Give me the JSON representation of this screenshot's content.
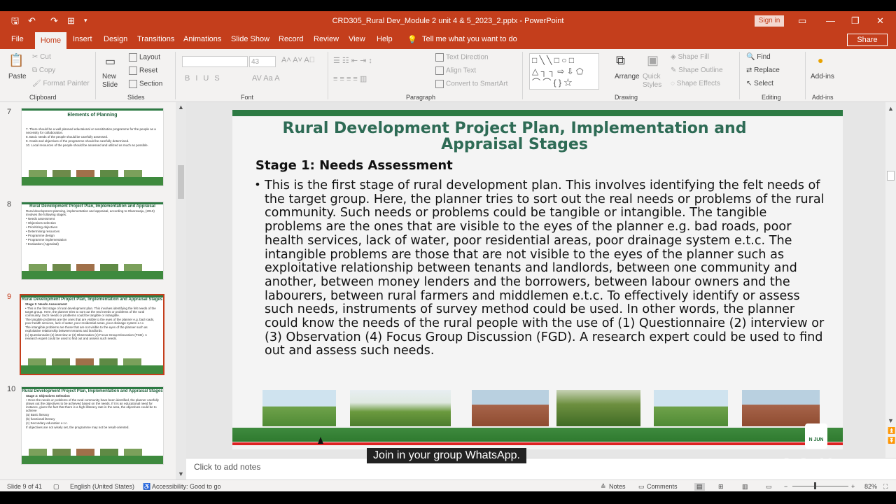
{
  "window": {
    "doc_title": "CRD305_Rural Dev_Module 2 unit 4 & 5_2023_2.pptx  -  PowerPoint",
    "sign_in": "Sign in",
    "share": "Share"
  },
  "tabs": [
    "File",
    "Home",
    "Insert",
    "Design",
    "Transitions",
    "Animations",
    "Slide Show",
    "Record",
    "Review",
    "View",
    "Help"
  ],
  "tell_me": "Tell me what you want to do",
  "ribbon": {
    "clipboard": {
      "paste": "Paste",
      "cut": "Cut",
      "copy": "Copy",
      "format_painter": "Format Painter",
      "group": "Clipboard"
    },
    "slides": {
      "new_slide": "New Slide",
      "layout": "Layout",
      "reset": "Reset",
      "section": "Section",
      "group": "Slides"
    },
    "font": {
      "font_size": "43",
      "group": "Font"
    },
    "paragraph": {
      "text_direction": "Text Direction",
      "align_text": "Align Text",
      "convert": "Convert to SmartArt",
      "group": "Paragraph"
    },
    "drawing": {
      "arrange": "Arrange",
      "quick_styles": "Quick Styles",
      "shape_fill": "Shape Fill",
      "shape_outline": "Shape Outline",
      "shape_effects": "Shape Effects",
      "group": "Drawing"
    },
    "editing": {
      "find": "Find",
      "replace": "Replace",
      "select": "Select",
      "group": "Editing"
    },
    "addins": {
      "label": "Add-ins",
      "group": "Add-ins"
    }
  },
  "thumbnails": [
    {
      "num": "7",
      "title": "Elements of Planning",
      "lines": [
        "7. There should be a well planned educational or sensitization programme for the people as a necessity for collaboration.",
        "8. Basic needs of the people should be carefully assessed.",
        "9. Goals and objectives of the programme should be carefully determined.",
        "10. Local resources of the people should be assessed and utilized as much as possible."
      ]
    },
    {
      "num": "8",
      "title": "Rural Development Project Plan, Implementation and Appraisal",
      "lines": [
        "Rural development planning, implementation and appraisal, according to Olanrewaju, (2010) involves the following stages:",
        "• Needs assessment",
        "• Objectives selection",
        "• Prioritizing objectives",
        "• Determining resources",
        "• Programme design",
        "• Programme implementation",
        "• Evaluation (Appraisal)"
      ]
    },
    {
      "num": "9",
      "title": "Rural Development Project Plan, Implementation and Appraisal Stages",
      "lines": [
        "Stage 1: Needs Assessment",
        "• This is the first stage of rural development plan. This involves identifying the felt needs of the target group. Here, the planner tries to sort out the real needs or problems of the rural community. Such needs or problems could be tangible or intangible.",
        "The tangible problems are the ones that are visible to the eyes of the planner e.g. bad roads, poor health services, lack of water, poor residential areas, poor drainage system e.t.c.",
        "The intangible problems are those that are not visible to the eyes of the planner such as exploitative relationship between tenants and landlords.",
        "(1) Questionnaire (2) interview or (3) Observation (4) Focus Group Discussion (FGD). A research expert could be used to find out and assess such needs."
      ]
    },
    {
      "num": "10",
      "title": "Rural Development Project Plan, Implementation and Appraisal Stages",
      "lines": [
        "Stage 2: Objectives Selection",
        "• Once the needs or problems of the rural community have been identified, the planner carefully draws out the objectives to be achieved based on the needs. If it is an educational need for instance, given the fact that there is a high illiteracy rate in the area, the objectives could be to achieve",
        "(a) Basic literacy",
        "(b) functional literacy",
        "(c) Secondary education e.t.c.",
        "If objectives are not wisely set, the programme may not be result-oriented."
      ]
    }
  ],
  "slide": {
    "title": "Rural Development Project Plan, Implementation and Appraisal Stages",
    "heading": "Stage 1: Needs Assessment",
    "bullet": "•",
    "body": "This is the first stage of rural development plan. This involves identifying the felt needs of the target group. Here, the planner tries to sort out the real needs or problems of the rural community. Such needs or problems could be tangible or intangible. The tangible problems are the ones that are visible to the eyes of the planner e.g. bad roads, poor health services, lack of water, poor residential areas, poor drainage system e.t.c. The intangible problems are those that are not visible to the eyes of the planner such as exploitative relationship between tenants and landlords, between one community and another, between money lenders and the borrowers, between labour owners and the labourers, between rural farmers and middlemen e.t.c. To effectively identify or assess such needs, instruments of survey method could be used. In other words, the planner could know the needs of the rural people with the use of (1) Questionnaire (2) interview or (3) Observation (4) Focus Group Discussion (FGD). A research expert could be used to find out and assess such needs.",
    "logo_text": "N JUN"
  },
  "caption": "Join in your group WhatsApp.",
  "notes_placeholder": "Click to add notes",
  "zoom_watermark": "zoom",
  "status": {
    "slide": "Slide 9 of 41",
    "language": "English (United States)",
    "accessibility": "Accessibility: Good to go",
    "notes": "Notes",
    "comments": "Comments",
    "zoom": "82%"
  },
  "colors": {
    "accent": "#c43e1c",
    "slide_green": "#2d7a43",
    "title_green": "#2e6b55"
  }
}
